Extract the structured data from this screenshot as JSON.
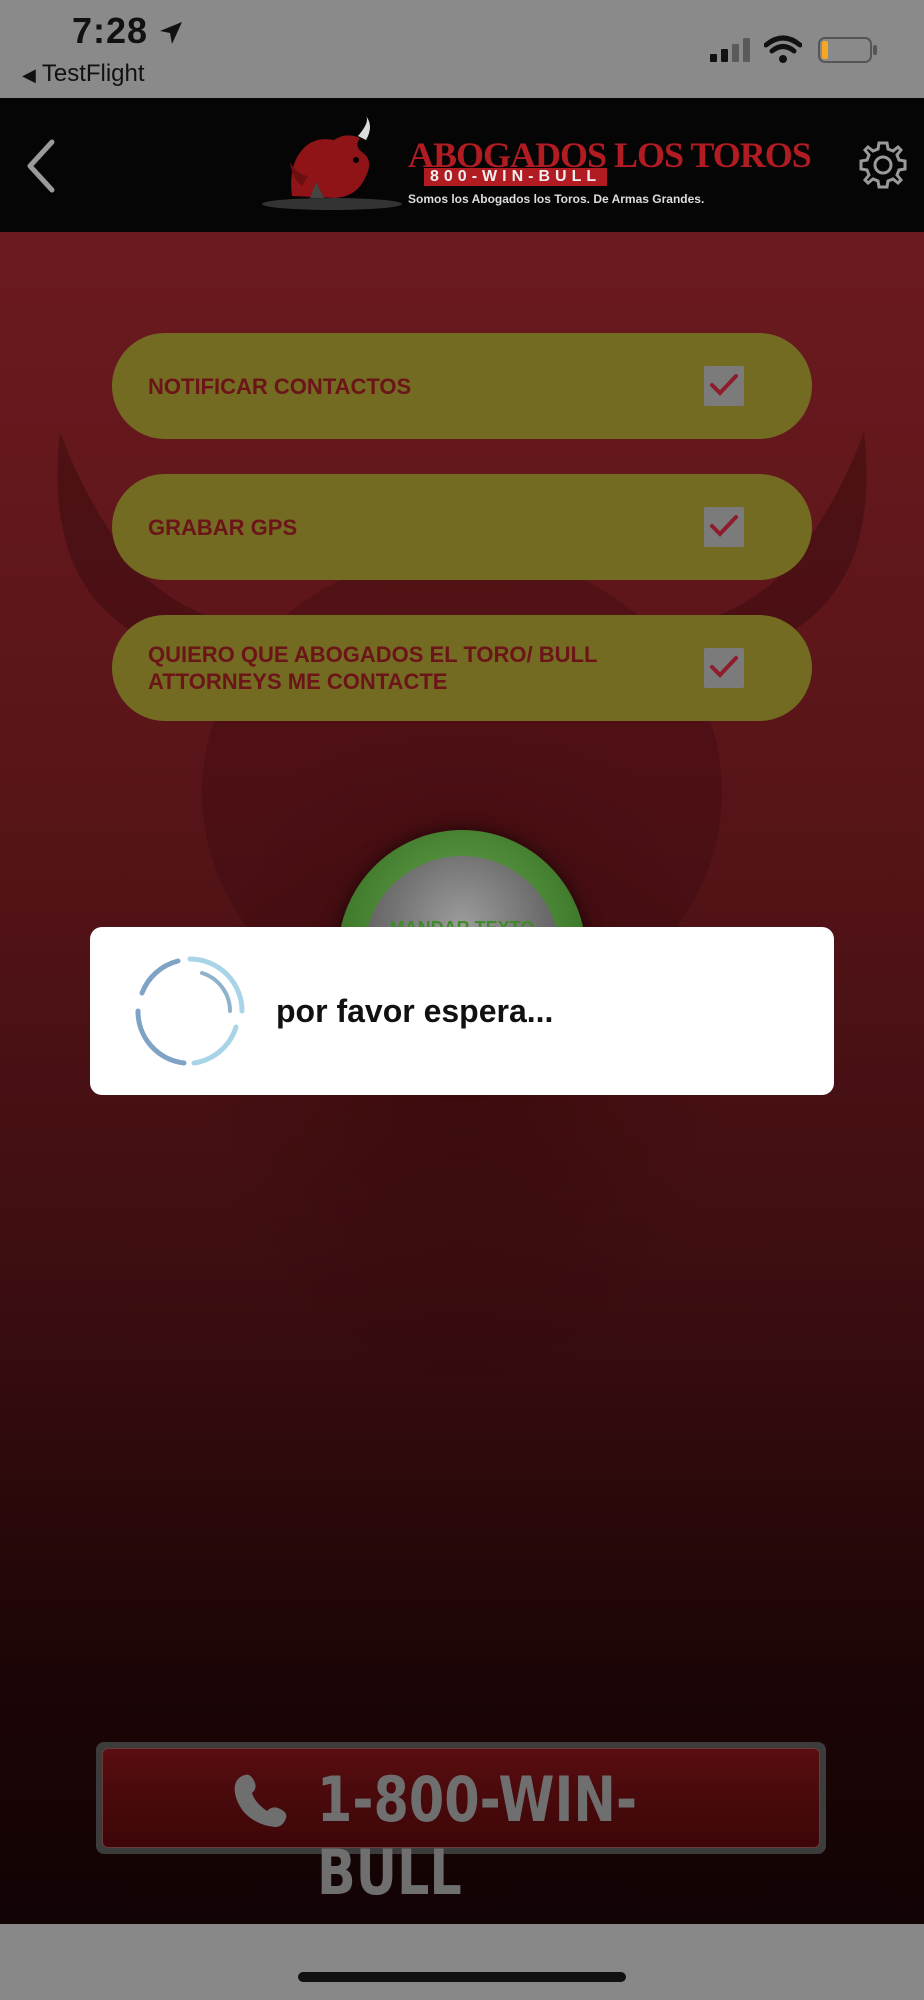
{
  "status_bar": {
    "time": "7:28",
    "back_app": "TestFlight"
  },
  "header": {
    "logo": {
      "title": "ABOGADOS LOS TOROS",
      "phone": "800-WIN-BULL",
      "tagline": "Somos los Abogados los Toros. De Armas Grandes."
    }
  },
  "options": [
    {
      "label": "NOTIFICAR CONTACTOS",
      "checked": true
    },
    {
      "label": "GRABAR GPS",
      "checked": true
    },
    {
      "label": "QUIERO QUE ABOGADOS EL TORO/ BULL ATTORNEYS ME CONTACTE",
      "checked": true
    }
  ],
  "send_button": {
    "label": "MANDAR TEXTO"
  },
  "call_button": {
    "label": "1-800-WIN-BULL"
  },
  "modal": {
    "message": "por favor espera..."
  },
  "colors": {
    "option_bg": "#736b22",
    "option_text": "#6b1518",
    "header_bg": "#050505",
    "check_color": "#8e1c2b"
  }
}
